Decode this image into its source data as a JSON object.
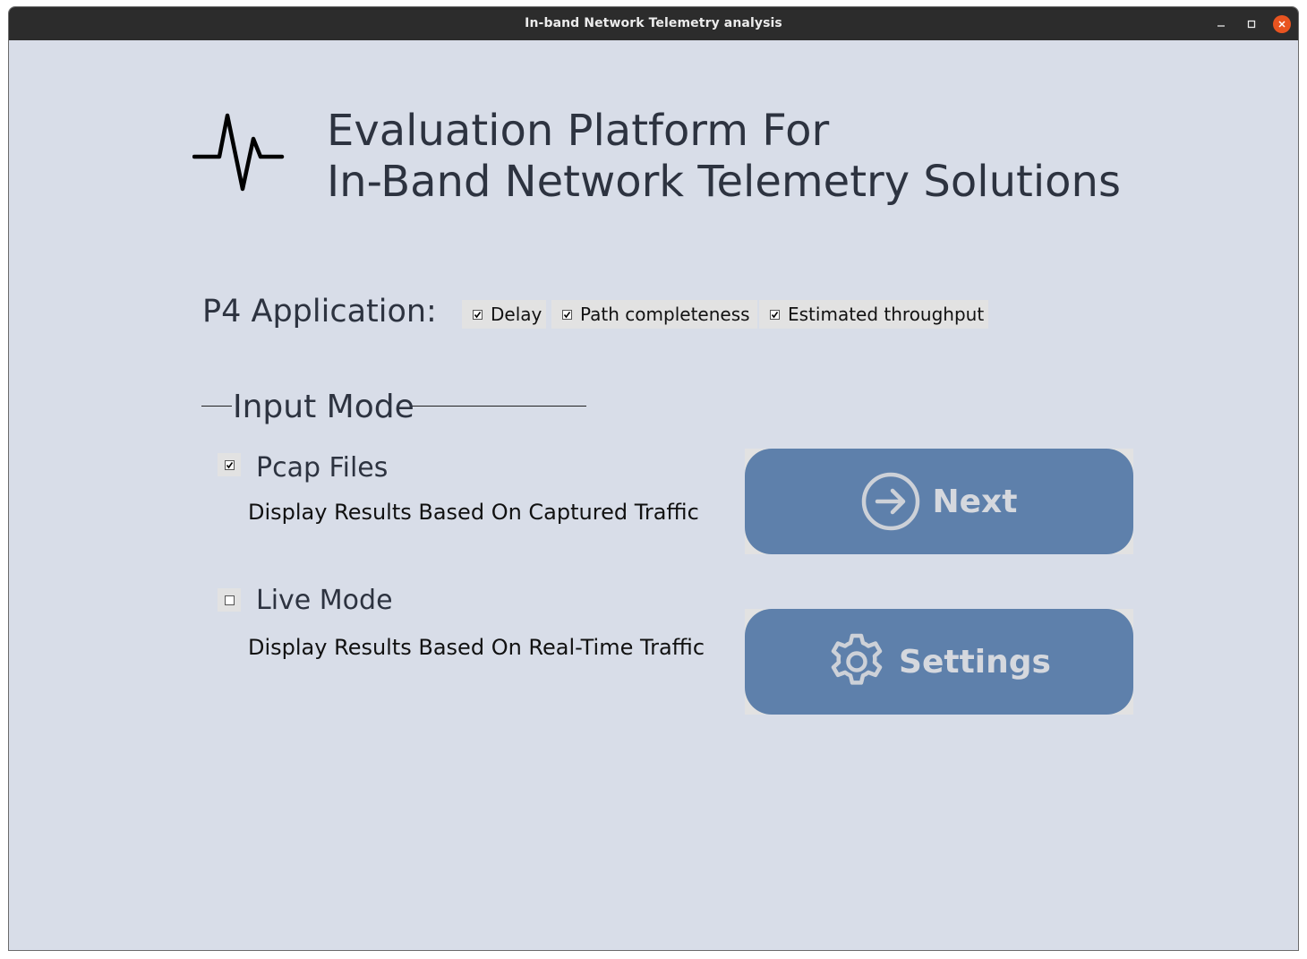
{
  "window": {
    "title": "In-band Network Telemetry analysis",
    "controls": [
      "minimize",
      "maximize",
      "close"
    ]
  },
  "header": {
    "icon": "pulse-icon",
    "title_line1": "Evaluation Platform For",
    "title_line2": "In-Band Network Telemetry Solutions"
  },
  "p4_application": {
    "label": "P4 Application:",
    "options": [
      {
        "label": "Delay",
        "checked": true
      },
      {
        "label": "Path completeness",
        "checked": true
      },
      {
        "label": "Estimated throughput",
        "checked": true
      }
    ]
  },
  "input_mode": {
    "title": "Input Mode",
    "modes": [
      {
        "title": "Pcap Files",
        "description": "Display Results Based On Captured Traffic",
        "checked": true
      },
      {
        "title": "Live Mode",
        "description": "Display Results Based On Real-Time Traffic",
        "checked": false
      }
    ]
  },
  "buttons": {
    "next_label": "Next",
    "next_icon": "arrow-circle-right-icon",
    "settings_label": "Settings",
    "settings_icon": "gear-icon"
  },
  "colors": {
    "background": "#d8dde8",
    "titlebar": "#2c2c2c",
    "button": "#5e80ab",
    "button_text": "#d5d8de",
    "close": "#e95420"
  }
}
